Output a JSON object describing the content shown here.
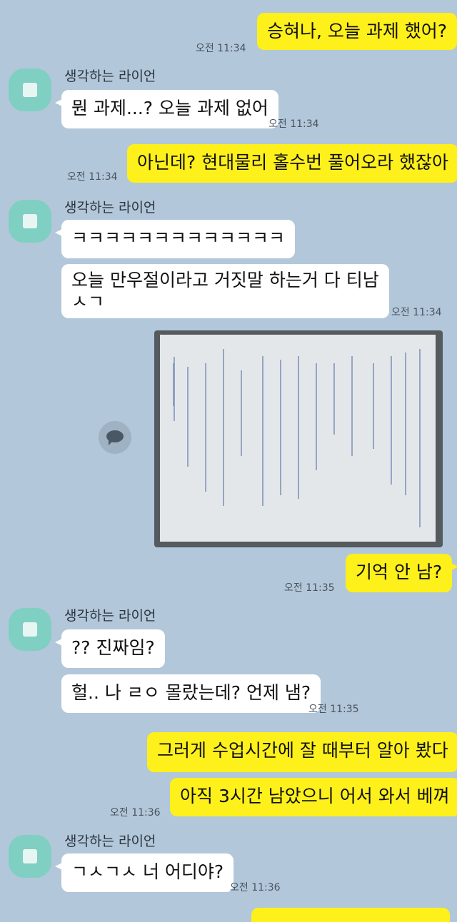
{
  "contact": {
    "name": "생각하는 라이언"
  },
  "messages": {
    "m1": {
      "text": "승혀나, 오늘 과제 했어?",
      "time": "오전 11:34"
    },
    "m2": {
      "text": "뭔 과제...? 오늘 과제 없어",
      "time": "오전 11:34"
    },
    "m3": {
      "text": "아닌데? 현대물리 홀수번 풀어오라 했잖아",
      "time": "오전 11:34"
    },
    "m4": {
      "text": "ㅋㅋㅋㅋㅋㅋㅋㅋㅋㅋㅋㅋㅋ"
    },
    "m5": {
      "line1": "오늘 만우절이라고 거짓말 하는거 다 티남",
      "line2": "ㅅㄱ",
      "time": "오전 11:34"
    },
    "m6": {
      "text": "기억 안 남?",
      "time": "오전 11:35"
    },
    "m7": {
      "text": "?? 진짜임?"
    },
    "m8": {
      "text": "헐.. 나 ㄹㅇ 몰랐는데? 언제 냄?",
      "time": "오전 11:35"
    },
    "m9": {
      "text": "그러게 수업시간에 잘 때부터 알아 봤다"
    },
    "m10": {
      "text": "아직 3시간 남았으니 어서 와서 베껴",
      "time": "오전 11:36"
    },
    "m11": {
      "text": "ㄱㅅㄱㅅ 너 어디야?",
      "time": "오전 11:36"
    }
  },
  "colors": {
    "background": "#b2c7d9",
    "my_bubble": "#fef01b",
    "their_bubble": "#ffffff",
    "avatar": "#7fcfc2"
  },
  "icons": {
    "share": "share-icon",
    "avatar": "avatar"
  }
}
